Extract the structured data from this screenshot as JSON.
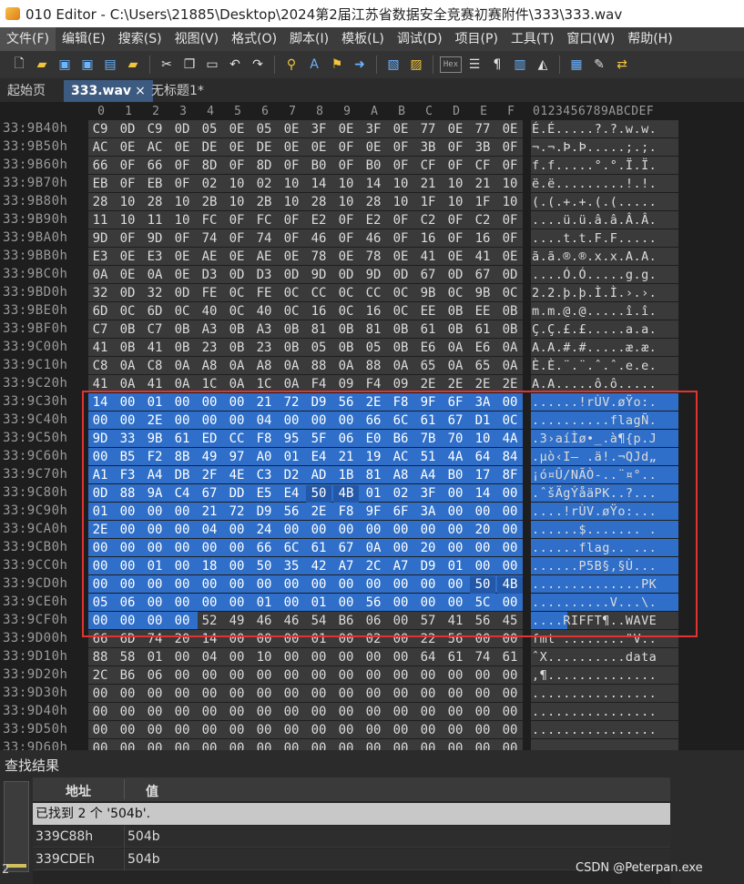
{
  "window": {
    "title": "010 Editor - C:\\Users\\21885\\Desktop\\2024第2届江苏省数据安全竞赛初赛附件\\333\\333.wav"
  },
  "menu": [
    "文件(F)",
    "编辑(E)",
    "搜索(S)",
    "视图(V)",
    "格式(O)",
    "脚本(I)",
    "模板(L)",
    "调试(D)",
    "项目(P)",
    "工具(T)",
    "窗口(W)",
    "帮助(H)"
  ],
  "toolbar": {
    "hex_label": "Hex",
    "icons": [
      "new-file-icon",
      "open-folder-icon",
      "save-icon",
      "save-as-icon",
      "save-all-icon",
      "open-file-icon",
      "cut-icon",
      "copy-icon",
      "paste-icon",
      "undo-icon",
      "redo-icon",
      "find-icon",
      "replace-icon",
      "find-in-files-icon",
      "goto-icon",
      "copy-as-icon",
      "compare-icon",
      "hex-mode-icon",
      "columns-icon",
      "paragraph-icon",
      "split-icon",
      "highlight-icon",
      "calculator-icon",
      "template-icon",
      "swap-icon"
    ]
  },
  "tabs": {
    "start_page": "起始页",
    "active": "333.wav",
    "close": "×",
    "untitled": "无标题1*"
  },
  "hex_header": {
    "columns": [
      "0",
      "1",
      "2",
      "3",
      "4",
      "5",
      "6",
      "7",
      "8",
      "9",
      "A",
      "B",
      "C",
      "D",
      "E",
      "F"
    ],
    "ascii_header": "0123456789ABCDEF"
  },
  "rows": [
    {
      "addr": "33:9B40h",
      "hex": "C9 0D C9 0D 05 0E 05 0E 3F 0E 3F 0E 77 0E 77 0E",
      "ascii": "É.É.....?.?.w.w."
    },
    {
      "addr": "33:9B50h",
      "hex": "AC 0E AC 0E DE 0E DE 0E 0E 0F 0E 0F 3B 0F 3B 0F",
      "ascii": "¬.¬.Þ.Þ.....;.;."
    },
    {
      "addr": "33:9B60h",
      "hex": "66 0F 66 0F 8D 0F 8D 0F B0 0F B0 0F CF 0F CF 0F",
      "ascii": "f.f.....°.°.Ï.Ï."
    },
    {
      "addr": "33:9B70h",
      "hex": "EB 0F EB 0F 02 10 02 10 14 10 14 10 21 10 21 10",
      "ascii": "ë.ë.........!.!."
    },
    {
      "addr": "33:9B80h",
      "hex": "28 10 28 10 2B 10 2B 10 28 10 28 10 1F 10 1F 10",
      "ascii": "(.(.+.+.(.(....."
    },
    {
      "addr": "33:9B90h",
      "hex": "11 10 11 10 FC 0F FC 0F E2 0F E2 0F C2 0F C2 0F",
      "ascii": "....ü.ü.â.â.Â.Â."
    },
    {
      "addr": "33:9BA0h",
      "hex": "9D 0F 9D 0F 74 0F 74 0F 46 0F 46 0F 16 0F 16 0F",
      "ascii": "....t.t.F.F....."
    },
    {
      "addr": "33:9BB0h",
      "hex": "E3 0E E3 0E AE 0E AE 0E 78 0E 78 0E 41 0E 41 0E",
      "ascii": "ã.ã.®.®.x.x.A.A."
    },
    {
      "addr": "33:9BC0h",
      "hex": "0A 0E 0A 0E D3 0D D3 0D 9D 0D 9D 0D 67 0D 67 0D",
      "ascii": "....Ó.Ó.....g.g."
    },
    {
      "addr": "33:9BD0h",
      "hex": "32 0D 32 0D FE 0C FE 0C CC 0C CC 0C 9B 0C 9B 0C",
      "ascii": "2.2.þ.þ.Ì.Ì.›.›."
    },
    {
      "addr": "33:9BE0h",
      "hex": "6D 0C 6D 0C 40 0C 40 0C 16 0C 16 0C EE 0B EE 0B",
      "ascii": "m.m.@.@.....î.î."
    },
    {
      "addr": "33:9BF0h",
      "hex": "C7 0B C7 0B A3 0B A3 0B 81 0B 81 0B 61 0B 61 0B",
      "ascii": "Ç.Ç.£.£.....a.a."
    },
    {
      "addr": "33:9C00h",
      "hex": "41 0B 41 0B 23 0B 23 0B 05 0B 05 0B E6 0A E6 0A",
      "ascii": "A.A.#.#.....æ.æ."
    },
    {
      "addr": "33:9C10h",
      "hex": "C8 0A C8 0A A8 0A A8 0A 88 0A 88 0A 65 0A 65 0A",
      "ascii": "È.È.¨.¨.ˆ.ˆ.e.e."
    },
    {
      "addr": "33:9C20h",
      "hex": "41 0A 41 0A 1C 0A 1C 0A F4 09 F4 09 2E 2E 2E 2E",
      "ascii": "A.A.....ô.ô....."
    },
    {
      "addr": "33:9C30h",
      "hex": "14 00 01 00 00 00 21 72 D9 56 2E F8 9F 6F 3A 00",
      "ascii": "......!rÙV.øŸo:."
    },
    {
      "addr": "33:9C40h",
      "hex": "00 00 2E 00 00 00 04 00 00 00 66 6C 61 67 D1 0C",
      "ascii": "..........flagÑ."
    },
    {
      "addr": "33:9C50h",
      "hex": "9D 33 9B 61 ED CC F8 95 5F 06 E0 B6 7B 70 10 4A",
      "ascii": ".3›aíÌø•_.à¶{p.J"
    },
    {
      "addr": "33:9C60h",
      "hex": "00 B5 F2 8B 49 97 A0 01 E4 21 19 AC 51 4A 64 84",
      "ascii": ".µò‹I— .ä!.¬QJd„"
    },
    {
      "addr": "33:9C70h",
      "hex": "A1 F3 A4 DB 2F 4E C3 D2 AD 1B 81 A8 A4 B0 17 8F",
      "ascii": "¡ó¤Û/NÃÒ-..¨¤°.."
    },
    {
      "addr": "33:9C80h",
      "hex": "0D 88 9A C4 67 DD E5 E4 50 4B 01 02 3F 00 14 00",
      "ascii": ".ˆšÄgÝåäPK..?..."
    },
    {
      "addr": "33:9C90h",
      "hex": "01 00 00 00 21 72 D9 56 2E F8 9F 6F 3A 00 00 00",
      "ascii": "....!rÙV.øŸo:..."
    },
    {
      "addr": "33:9CA0h",
      "hex": "2E 00 00 00 04 00 24 00 00 00 00 00 00 00 20 00",
      "ascii": "......$....... ."
    },
    {
      "addr": "33:9CB0h",
      "hex": "00 00 00 00 00 00 66 6C 61 67 0A 00 20 00 00 00",
      "ascii": "......flag.. ..."
    },
    {
      "addr": "33:9CC0h",
      "hex": "00 00 01 00 18 00 50 35 42 A7 2C A7 D9 01 00 00",
      "ascii": "......P5B§,§Ù..."
    },
    {
      "addr": "33:9CD0h",
      "hex": "00 00 00 00 00 00 00 00 00 00 00 00 00 00 50 4B",
      "ascii": "..............PK"
    },
    {
      "addr": "33:9CE0h",
      "hex": "05 06 00 00 00 00 01 00 01 00 56 00 00 00 5C 00",
      "ascii": "..........V...\\."
    },
    {
      "addr": "33:9CF0h",
      "hex": "00 00 00 00 52 49 46 46 54 B6 06 00 57 41 56 45",
      "ascii": "....RIFFT¶..WAVE"
    },
    {
      "addr": "33:9D00h",
      "hex": "66 6D 74 20 14 00 00 00 01 00 02 00 22 56 00 00",
      "ascii": "fmt ........\"V.."
    },
    {
      "addr": "33:9D10h",
      "hex": "88 58 01 00 04 00 10 00 00 00 00 00 64 61 74 61",
      "ascii": "ˆX..........data"
    },
    {
      "addr": "33:9D20h",
      "hex": "2C B6 06 00 00 00 00 00 00 00 00 00 00 00 00 00",
      "ascii": ",¶.............."
    },
    {
      "addr": "33:9D30h",
      "hex": "00 00 00 00 00 00 00 00 00 00 00 00 00 00 00 00",
      "ascii": "................"
    },
    {
      "addr": "33:9D40h",
      "hex": "00 00 00 00 00 00 00 00 00 00 00 00 00 00 00 00",
      "ascii": "................"
    },
    {
      "addr": "33:9D50h",
      "hex": "00 00 00 00 00 00 00 00 00 00 00 00 00 00 00 00",
      "ascii": "................"
    },
    {
      "addr": "33:9D60h",
      "hex": "00 00 00 00 00 00 00 00 00 00 00 00 00 00 00 00",
      "ascii": "................"
    }
  ],
  "results": {
    "title": "查找结果",
    "col_address": "地址",
    "col_value": "值",
    "found_text": "已找到 2 个 '504b'.",
    "items": [
      {
        "address": "339C88h",
        "value": "504b"
      },
      {
        "address": "339CDEh",
        "value": "504b"
      }
    ],
    "count": "2"
  },
  "watermark": "CSDN @Peterpan.exe",
  "colors": {
    "selection": "#2f6fc9",
    "found_highlight": "#2358a8",
    "annotation_box": "#e23232",
    "active_tab": "#3d5a80"
  }
}
